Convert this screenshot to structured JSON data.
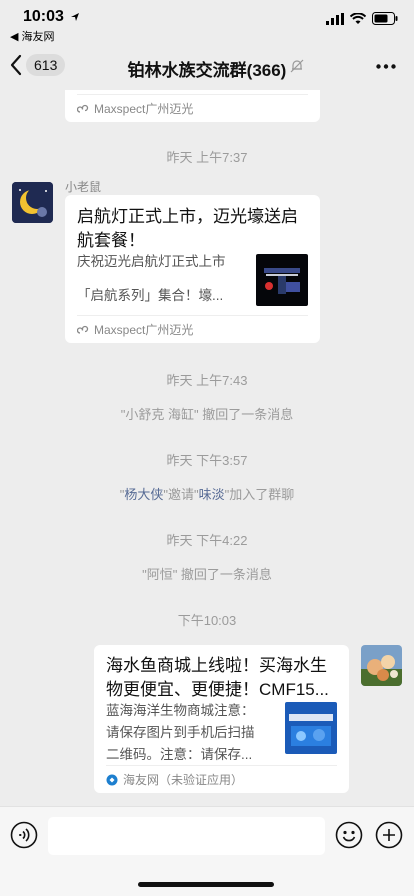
{
  "status": {
    "time": "10:03",
    "back_app": "◀ 海友网"
  },
  "nav": {
    "unread_count": "613",
    "title": "铂林水族交流群(366)"
  },
  "messages": {
    "card0": {
      "source": "Maxspect广州迈光"
    },
    "time1": "昨天 上午7:37",
    "card1": {
      "sender": "小老鼠",
      "title_line1": "启航灯正式上市，迈光壕送启",
      "title_line2": "航套餐！",
      "desc_line1": "庆祝迈光启航灯正式上市",
      "desc_line2": "「启航系列」集合！壕...",
      "source": "Maxspect广州迈光"
    },
    "time2": "昨天 上午7:43",
    "sys1": "\"小舒克 海缸\" 撤回了一条消息",
    "time3": "昨天 下午3:57",
    "sys2": {
      "q1": "\"",
      "inviter": "杨大侠",
      "mid": "\"邀请\"",
      "invitee": "味淡",
      "tail": "\"加入了群聊"
    },
    "time4": "昨天 下午4:22",
    "sys3": "\"阿恒\" 撤回了一条消息",
    "time5": "下午10:03",
    "card2": {
      "title_line1": "海水鱼商城上线啦！买海水生",
      "title_line2": "物更便宜、更便捷！CMF15...",
      "desc_line1": "蓝海海洋生物商城注意：",
      "desc_line2": "请保存图片到手机后扫描",
      "desc_line3": "二维码。注意：请保存...",
      "source": "海友网（未验证应用）"
    }
  },
  "icons": {
    "back": "chevron-left-icon",
    "mute": "bell-slash-icon",
    "more": "ellipsis-icon",
    "voice": "voice-icon",
    "emoji": "emoji-icon",
    "plus": "plus-icon",
    "miniprogram": "miniprogram-icon",
    "app": "app-icon"
  },
  "colors": {
    "background": "#ededed",
    "card": "#ffffff",
    "link": "#576b95",
    "muted_text": "#9b9b9b"
  }
}
